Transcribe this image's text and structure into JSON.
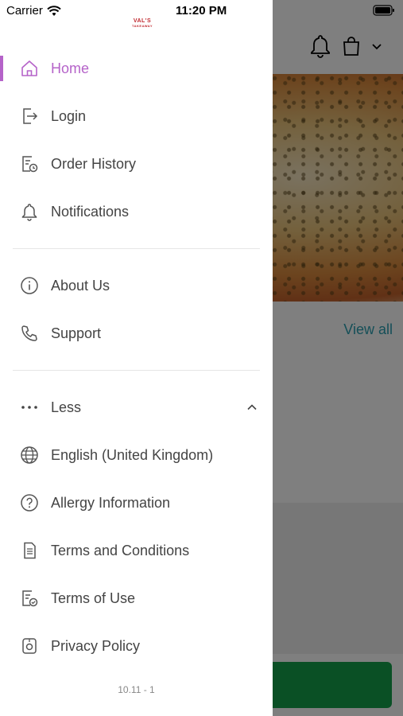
{
  "status_bar": {
    "carrier": "Carrier",
    "time": "11:20 PM"
  },
  "logo": {
    "line1": "VAL'S",
    "line2": "TAKEAWAY"
  },
  "menu": {
    "primary": [
      {
        "label": "Home",
        "icon": "home-icon",
        "active": true
      },
      {
        "label": "Login",
        "icon": "login-icon"
      },
      {
        "label": "Order History",
        "icon": "order-history-icon"
      },
      {
        "label": "Notifications",
        "icon": "bell-icon"
      }
    ],
    "secondary": [
      {
        "label": "About Us",
        "icon": "info-icon"
      },
      {
        "label": "Support",
        "icon": "phone-icon"
      }
    ],
    "more_toggle": {
      "label": "Less",
      "icon": "ellipsis-icon",
      "state": "expanded"
    },
    "extra": [
      {
        "label": "English (United Kingdom)",
        "icon": "globe-icon"
      },
      {
        "label": "Allergy Information",
        "icon": "question-icon"
      },
      {
        "label": "Terms and Conditions",
        "icon": "document-icon"
      },
      {
        "label": "Terms of Use",
        "icon": "document-check-icon"
      },
      {
        "label": "Privacy Policy",
        "icon": "privacy-icon"
      }
    ]
  },
  "version": "10.11 - 1",
  "background": {
    "view_all": "View all"
  },
  "colors": {
    "accent": "#b563c9",
    "text": "#444444",
    "link": "#2a9fb0",
    "cta": "#14a04a"
  }
}
